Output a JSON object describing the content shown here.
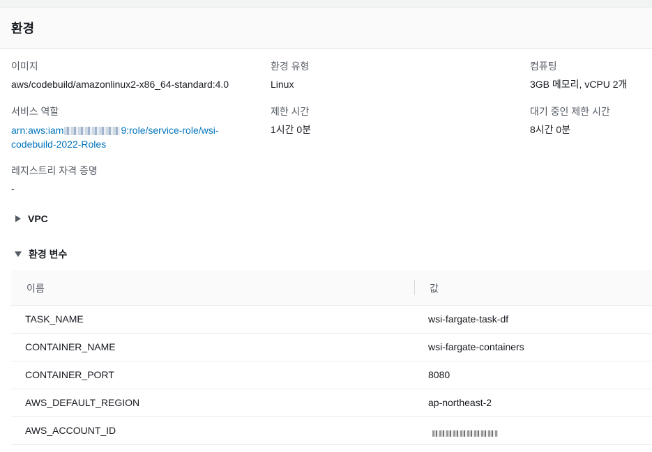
{
  "panel": {
    "title": "환경"
  },
  "fields": {
    "image": {
      "label": "이미지",
      "value": "aws/codebuild/amazonlinux2-x86_64-standard:4.0"
    },
    "env_type": {
      "label": "환경 유형",
      "value": "Linux"
    },
    "compute": {
      "label": "컴퓨팅",
      "value": "3GB 메모리, vCPU 2개"
    },
    "service_role": {
      "label": "서비스 역할",
      "value_prefix": "arn:aws:iam",
      "value_suffix_line1": "9:role/service-role/wsi-",
      "value_line2": "codebuild-2022-Roles"
    },
    "timeout": {
      "label": "제한 시간",
      "value": "1시간 0분"
    },
    "queued_timeout": {
      "label": "대기 중인 제한 시간",
      "value": "8시간 0분"
    },
    "registry_credential": {
      "label": "레지스트리 자격 증명",
      "value": "-"
    }
  },
  "expanders": {
    "vpc": {
      "label": "VPC",
      "icon": "caret-right-icon"
    },
    "env_vars": {
      "label": "환경 변수",
      "icon": "caret-down-icon"
    }
  },
  "env_table": {
    "columns": [
      "이름",
      "값"
    ],
    "rows": [
      {
        "name": "TASK_NAME",
        "value": "wsi-fargate-task-df"
      },
      {
        "name": "CONTAINER_NAME",
        "value": "wsi-fargate-containers"
      },
      {
        "name": "CONTAINER_PORT",
        "value": "8080"
      },
      {
        "name": "AWS_DEFAULT_REGION",
        "value": "ap-northeast-2"
      },
      {
        "name": "AWS_ACCOUNT_ID",
        "value": ""
      }
    ]
  },
  "colors": {
    "link": "#0073bb",
    "label": "#545b64",
    "text": "#16191f"
  }
}
